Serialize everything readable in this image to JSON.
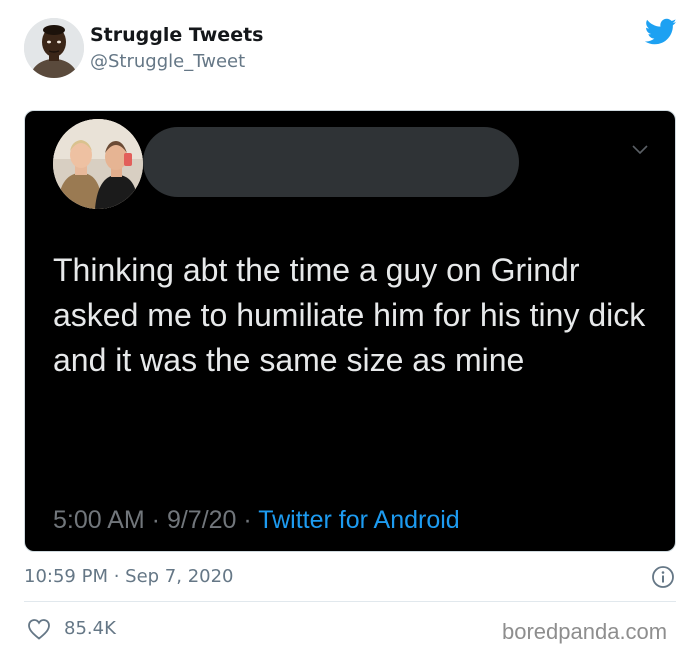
{
  "tweet": {
    "author": {
      "name": "Struggle Tweets",
      "handle": "@Struggle_Tweet",
      "avatar_icon": "person-avatar-icon"
    },
    "brand_icon": "twitter-bird-icon",
    "brand_color": "#1DA1F2",
    "embedded_tweet": {
      "background": "#000000",
      "avatar_icon": "two-people-photo-avatar-icon",
      "name_redacted": true,
      "text": "Thinking abt the time a guy on Grindr asked me to humiliate him for his tiny dick and it was the same size as mine",
      "time": "5:00 AM",
      "date": "9/7/20",
      "separator": " · ",
      "source": "Twitter for Android",
      "source_color": "#1D9BF0",
      "menu_icon": "chevron-down-icon"
    },
    "time": "10:59 PM",
    "separator": " · ",
    "date": "Sep 7, 2020",
    "info_icon": "info-icon",
    "like_icon": "heart-icon",
    "likes": "85.4K"
  },
  "watermark": "boredpanda.com"
}
